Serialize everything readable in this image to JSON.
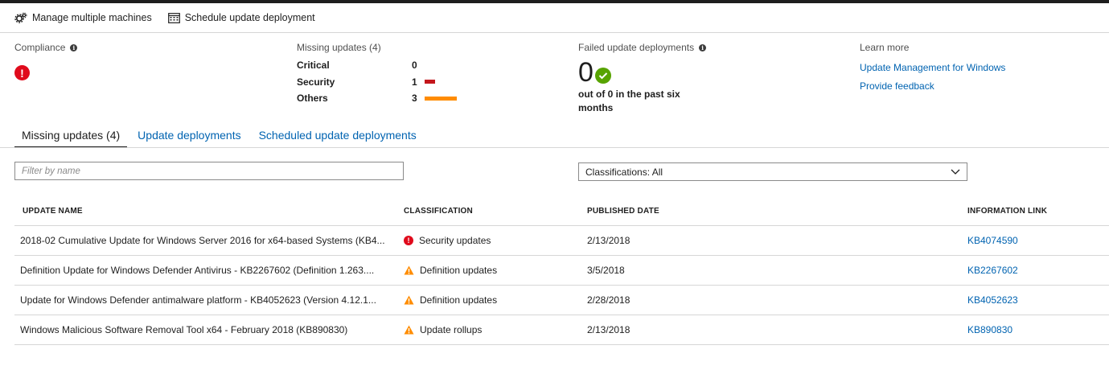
{
  "toolbar": {
    "manage_label": "Manage multiple machines",
    "schedule_label": "Schedule update deployment"
  },
  "compliance": {
    "title": "Compliance",
    "status_icon": "error-icon"
  },
  "missing_updates": {
    "title": "Missing updates (4)",
    "rows": [
      {
        "label": "Critical",
        "count": "0",
        "bar_color": ""
      },
      {
        "label": "Security",
        "count": "1",
        "bar_color": "#c4161c"
      },
      {
        "label": "Others",
        "count": "3",
        "bar_color": "#ff8c00"
      }
    ]
  },
  "failed": {
    "title": "Failed update deployments",
    "count": "0",
    "description": "out of 0 in the past six months"
  },
  "learn_more": {
    "title": "Learn more",
    "links": [
      "Update Management for Windows",
      "Provide feedback"
    ]
  },
  "tabs": [
    {
      "label": "Missing updates (4)",
      "active": true
    },
    {
      "label": "Update deployments",
      "active": false
    },
    {
      "label": "Scheduled update deployments",
      "active": false
    }
  ],
  "filter": {
    "placeholder": "Filter by name",
    "value": ""
  },
  "classification_filter": {
    "selected": "Classifications: All"
  },
  "table": {
    "headers": [
      "UPDATE NAME",
      "CLASSIFICATION",
      "PUBLISHED DATE",
      "INFORMATION LINK"
    ],
    "rows": [
      {
        "name": "2018-02 Cumulative Update for Windows Server 2016 for x64-based Systems (KB4...",
        "classification": "Security updates",
        "icon": "error-icon",
        "date": "2/13/2018",
        "link": "KB4074590"
      },
      {
        "name": "Definition Update for Windows Defender Antivirus - KB2267602 (Definition 1.263....",
        "classification": "Definition updates",
        "icon": "warning-icon",
        "date": "3/5/2018",
        "link": "KB2267602"
      },
      {
        "name": "Update for Windows Defender antimalware platform - KB4052623 (Version 4.12.1...",
        "classification": "Definition updates",
        "icon": "warning-icon",
        "date": "2/28/2018",
        "link": "KB4052623"
      },
      {
        "name": "Windows Malicious Software Removal Tool x64 - February 2018 (KB890830)",
        "classification": "Update rollups",
        "icon": "warning-icon",
        "date": "2/13/2018",
        "link": "KB890830"
      }
    ]
  },
  "colors": {
    "link": "#0063b1",
    "error": "#e00b1c",
    "warning": "#ff8c00",
    "success": "#57a300"
  }
}
